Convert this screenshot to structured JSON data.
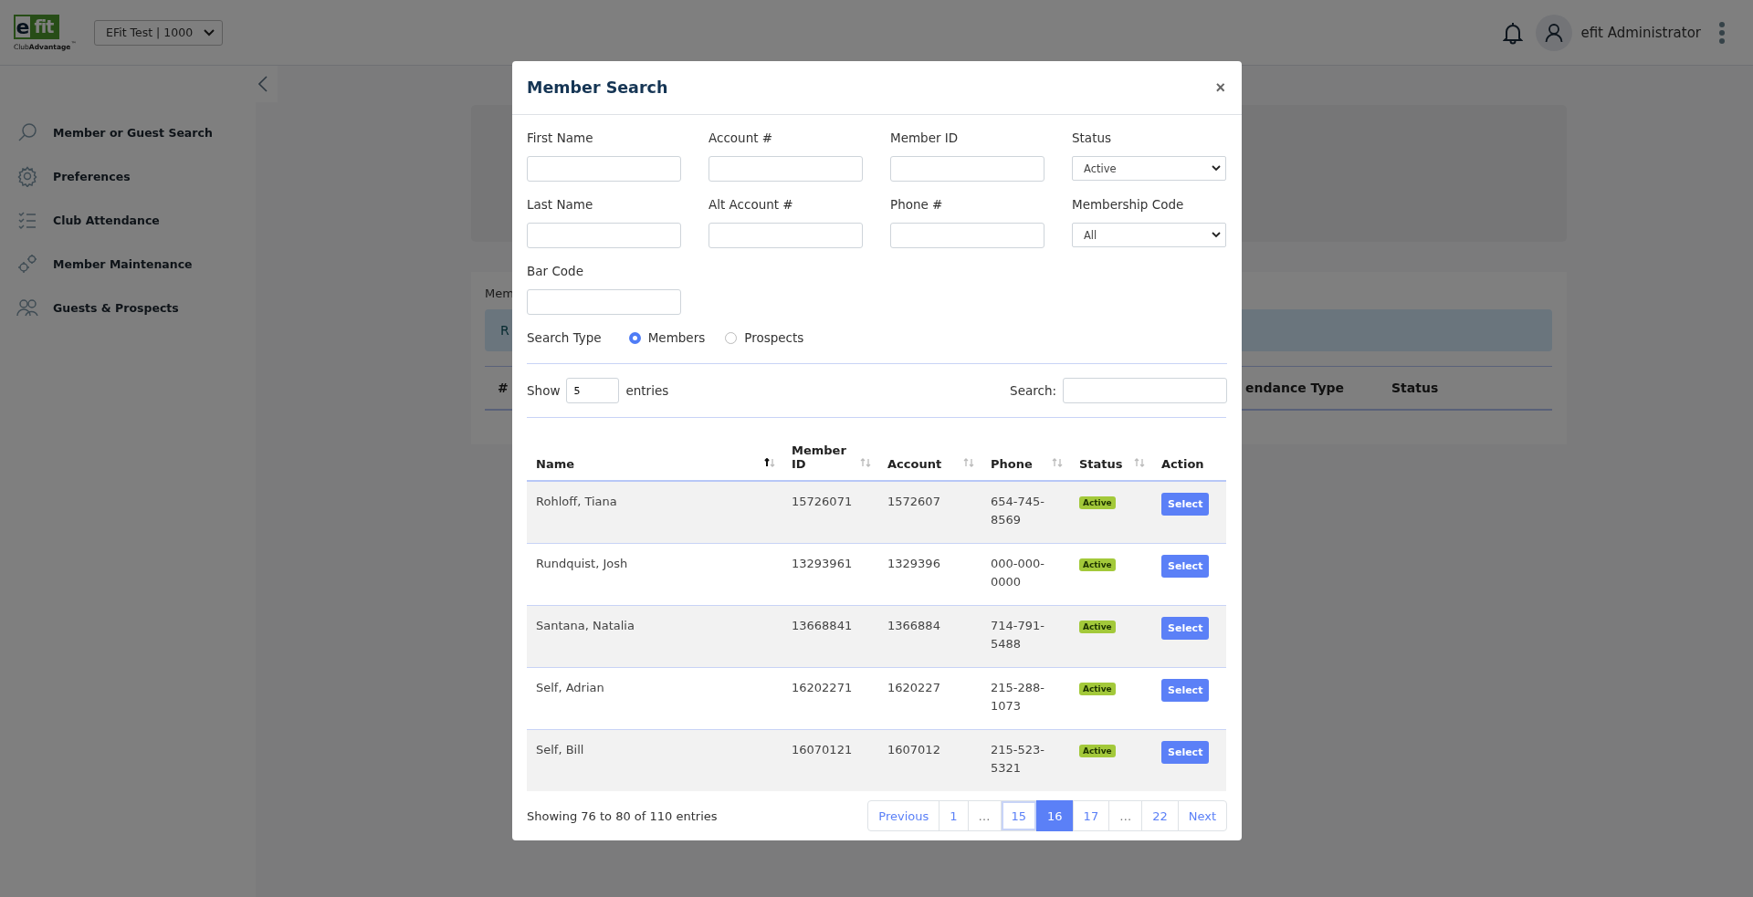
{
  "header": {
    "logo": {
      "letter": "e",
      "word": "fit",
      "tagline": "Club**Advantage**$^{™}$"
    },
    "club_select": "EFit Test | 1000",
    "user_name": "efit Administrator"
  },
  "sidebar": {
    "items": [
      {
        "label": "Member or Guest Search",
        "kind": "search"
      },
      {
        "label": "Preferences",
        "kind": "gear"
      },
      {
        "label": "Club Attendance",
        "kind": "checklist"
      },
      {
        "label": "Member Maintenance",
        "kind": "gears"
      },
      {
        "label": "Guests & Prospects",
        "kind": "people"
      }
    ]
  },
  "background": {
    "panel_title": "Mem",
    "alert_text": "R",
    "table_columns": [
      "#",
      "endance Type",
      "Status"
    ]
  },
  "modal": {
    "title": "Member Search",
    "close": "×",
    "fields": [
      {
        "label": "First Name",
        "kind": "input"
      },
      {
        "label": "Account #",
        "kind": "input"
      },
      {
        "label": "Member ID",
        "kind": "input"
      },
      {
        "label": "Status",
        "kind": "select",
        "value": "Active"
      },
      {
        "label": "Last Name",
        "kind": "input"
      },
      {
        "label": "Alt Account #",
        "kind": "input"
      },
      {
        "label": "Phone #",
        "kind": "input"
      },
      {
        "label": "Membership Code",
        "kind": "select",
        "value": "All"
      },
      {
        "label": "Bar Code",
        "kind": "input"
      }
    ],
    "search_type": {
      "label": "Search Type",
      "options": [
        {
          "label": "Members",
          "selected": true
        },
        {
          "label": "Prospects",
          "selected": false
        }
      ]
    },
    "length": {
      "before": "Show",
      "value": "5",
      "after": "entries"
    },
    "filter_label": "Search:",
    "table": {
      "columns": [
        {
          "label": "Name",
          "sorted_asc": true
        },
        {
          "label": "Member ID",
          "sorted_asc": false
        },
        {
          "label": "Account",
          "sorted_asc": false
        },
        {
          "label": "Phone",
          "sorted_asc": false
        },
        {
          "label": "Status",
          "sorted_asc": false
        },
        {
          "label": "Action"
        }
      ],
      "rows": [
        {
          "name": "Rohloff, Tiana",
          "member_id": "15726071",
          "account": "1572607",
          "phone": "654-745-8569",
          "status": "Active",
          "action": "Select"
        },
        {
          "name": "Rundquist, Josh",
          "member_id": "13293961",
          "account": "1329396",
          "phone": "000-000-0000",
          "status": "Active",
          "action": "Select"
        },
        {
          "name": "Santana, Natalia",
          "member_id": "13668841",
          "account": "1366884",
          "phone": "714-791-5488",
          "status": "Active",
          "action": "Select"
        },
        {
          "name": "Self, Adrian",
          "member_id": "16202271",
          "account": "1620227",
          "phone": "215-288-1073",
          "status": "Active",
          "action": "Select"
        },
        {
          "name": "Self, Bill",
          "member_id": "16070121",
          "account": "1607012",
          "phone": "215-523-5321",
          "status": "Active",
          "action": "Select"
        }
      ]
    },
    "info": "Showing 76 to 80 of 110 entries",
    "pagination": [
      {
        "label": "Previous",
        "kind": "nav",
        "selected": false,
        "focused": false
      },
      {
        "label": "1",
        "kind": "page",
        "selected": false,
        "focused": false
      },
      {
        "label": "…",
        "kind": "ellipsis",
        "selected": false,
        "focused": false
      },
      {
        "label": "15",
        "kind": "page",
        "selected": false,
        "focused": true
      },
      {
        "label": "16",
        "kind": "page",
        "selected": true,
        "focused": false
      },
      {
        "label": "17",
        "kind": "page",
        "selected": false,
        "focused": false
      },
      {
        "label": "…",
        "kind": "ellipsis",
        "selected": false,
        "focused": false
      },
      {
        "label": "22",
        "kind": "page",
        "selected": false,
        "focused": false
      },
      {
        "label": "Next",
        "kind": "nav",
        "selected": false,
        "focused": false
      }
    ]
  }
}
